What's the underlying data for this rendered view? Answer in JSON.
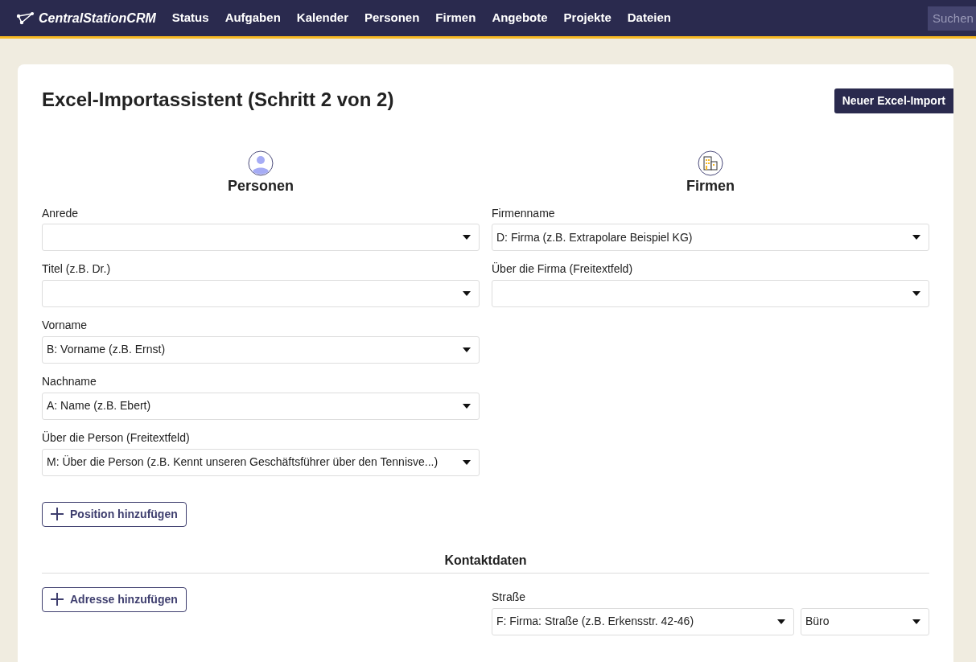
{
  "navbar": {
    "logo": "CentralStationCRM",
    "links": [
      "Status",
      "Aufgaben",
      "Kalender",
      "Personen",
      "Firmen",
      "Angebote",
      "Projekte",
      "Dateien"
    ],
    "search": {
      "placeholder": "Suchen"
    }
  },
  "page": {
    "title": "Excel-Importassistent (Schritt 2 von 2)",
    "new_import_button": "Neuer Excel-Import"
  },
  "columns": [
    {
      "heading": "Personen",
      "kind": "person",
      "fields": [
        {
          "label": "Anrede"
        },
        {
          "label": "Titel (z.B. Dr.)"
        },
        {
          "label": "Vorname",
          "value": "B: Vorname (z.B. Ernst)"
        },
        {
          "label": "Nachname",
          "value": "A: Name (z.B. Ebert)"
        },
        {
          "label": "Über die Person (Freitextfeld)",
          "value": "M: Über die Person (z.B. Kennt unseren Geschäftsführer über den Tennisve...)"
        }
      ]
    },
    {
      "heading": "Firmen",
      "kind": "company",
      "fields": [
        {
          "label": "Firmenname",
          "value": "D: Firma (z.B. Extrapolare Beispiel KG)"
        },
        {
          "label": "Über die Firma (Freitextfeld)"
        }
      ]
    }
  ],
  "add_position_button": "Position hinzufügen",
  "contact": {
    "heading": "Kontaktdaten",
    "add_address_button": "Adresse hinzufügen",
    "fields": [
      {
        "label": "Straße",
        "value": "F: Firma: Straße (z.B. Erkensstr. 42-46)",
        "type_value": "Büro"
      }
    ]
  }
}
